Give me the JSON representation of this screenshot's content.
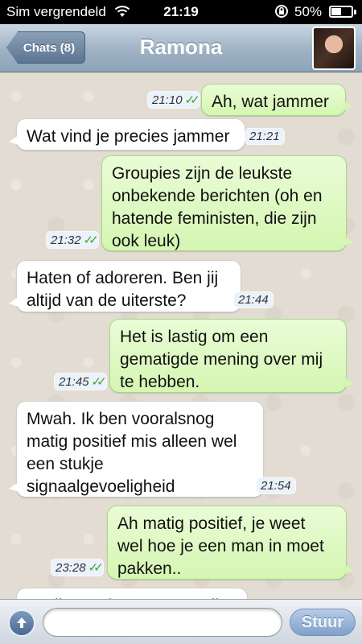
{
  "status_bar": {
    "carrier": "Sim vergrendeld",
    "time": "21:19",
    "battery_percent": "50%",
    "battery_level": 0.5
  },
  "nav": {
    "back_label": "Chats (8)",
    "title": "Ramona"
  },
  "messages": [
    {
      "direction": "out",
      "text": "Ah, wat jammer",
      "time": "21:10",
      "read": true
    },
    {
      "direction": "in",
      "text": "Wat vind je precies jammer",
      "time": "21:21"
    },
    {
      "direction": "out",
      "text": "Groupies zijn de leukste\nonbekende berichten (oh en\nhatende feministen, die zijn\nook leuk)",
      "time": "21:32",
      "read": true
    },
    {
      "direction": "in",
      "text": "Haten of adoreren. Ben jij\naltijd van de uiterste?",
      "time": "21:44"
    },
    {
      "direction": "out",
      "text": "Het is lastig om een\ngematigde mening over mij\nte hebben.",
      "time": "21:45",
      "read": true
    },
    {
      "direction": "in",
      "text": "Mwah. Ik ben vooralsnog\nmatig positief mis alleen wel\neen stukje\nsignaalgevoeligheid",
      "time": "21:54"
    },
    {
      "direction": "out",
      "text": "Ah matig positief, je weet\nwel hoe je een man in moet\npakken..",
      "time": "23:28",
      "read": true
    },
    {
      "direction": "in",
      "text": "K wil er wel een grote strik",
      "time": ""
    }
  ],
  "input": {
    "placeholder": "",
    "send_label": "Stuur"
  },
  "colors": {
    "outgoing_bubble": "#d5f6b2",
    "incoming_bubble": "#ffffff",
    "read_ticks": "#42a52e",
    "nav_bar": "#9fb2c4"
  }
}
